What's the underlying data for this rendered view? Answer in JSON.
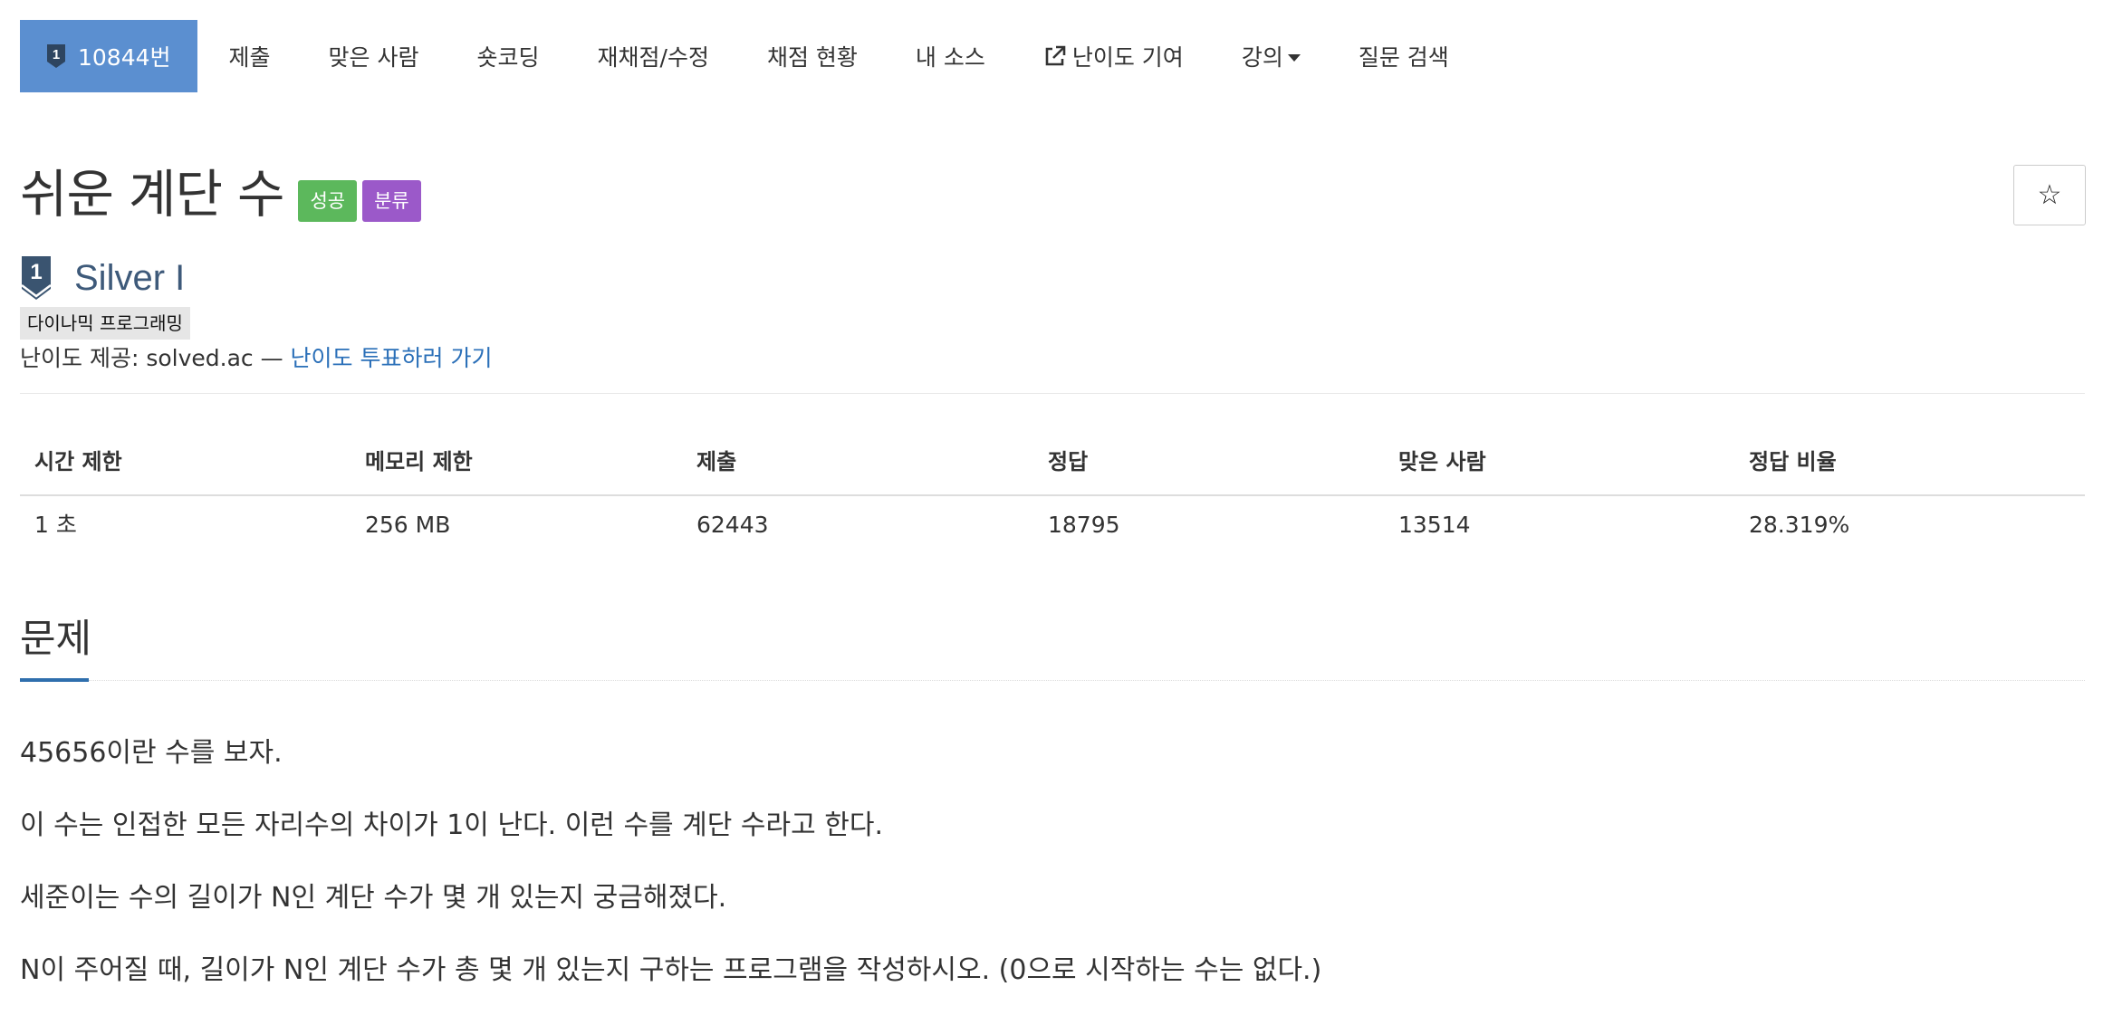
{
  "nav": {
    "problem_number": "10844번",
    "items": [
      "제출",
      "맞은 사람",
      "숏코딩",
      "재채점/수정",
      "채점 현황",
      "내 소스",
      "난이도 기여",
      "강의",
      "질문 검색"
    ]
  },
  "problem": {
    "title": "쉬운 계단 수",
    "labels": [
      "성공",
      "분류"
    ],
    "favorite_icon": "☆",
    "tier_icon_number": "1",
    "tier": "Silver I",
    "algorithm_tag": "다이나믹 프로그래밍",
    "difficulty_prefix": "난이도 제공: solved.ac — ",
    "difficulty_link": "난이도 투표하러 가기"
  },
  "stats": {
    "headers": [
      "시간 제한",
      "메모리 제한",
      "제출",
      "정답",
      "맞은 사람",
      "정답 비율"
    ],
    "values": [
      "1 초",
      "256 MB",
      "62443",
      "18795",
      "13514",
      "28.319%"
    ]
  },
  "section": {
    "title": "문제",
    "paragraphs": [
      "45656이란 수를 보자.",
      "이 수는 인접한 모든 자리수의 차이가 1이 난다. 이런 수를 계단 수라고 한다.",
      "세준이는 수의 길이가 N인 계단 수가 몇 개 있는지 궁금해졌다.",
      "N이 주어질 때, 길이가 N인 계단 수가 총 몇 개 있는지 구하는 프로그램을 작성하시오. (0으로 시작하는 수는 없다.)"
    ]
  },
  "colors": {
    "nav_active_bg": "#5b8fd0",
    "label_success": "#5cb85c",
    "label_class": "#9b59c9",
    "tier_color": "#3e5a7a",
    "link": "#2a6fb8",
    "section_accent": "#2f6fad"
  },
  "icons": {
    "tier": "silver-tier-badge-icon",
    "external_link": "external-link-icon",
    "dropdown": "caret-down-icon",
    "favorite": "star-outline-icon"
  }
}
